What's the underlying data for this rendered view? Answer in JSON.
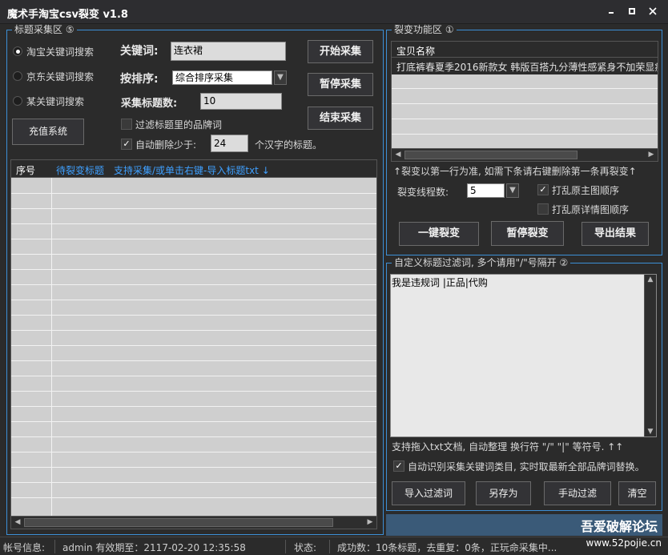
{
  "window": {
    "title": "魔术手淘宝csv裂变 v1.8",
    "controls": [
      "▫",
      "▫",
      "✕"
    ]
  },
  "collect_group": {
    "legend": "标题采集区 ⑤",
    "radios": [
      {
        "label": "淘宝关键词搜索",
        "checked": true
      },
      {
        "label": "京东关键词搜索",
        "checked": false
      },
      {
        "label": "某关键词搜索",
        "checked": false
      }
    ],
    "keyword_label": "关键词:",
    "keyword_value": "连衣裙",
    "sort_label": "按排序:",
    "sort_value": "综合排序采集",
    "count_label": "采集标题数:",
    "count_value": "10",
    "recharge_button": "充值系统",
    "filter_brand_label": "过滤标题里的品牌词",
    "auto_delete_label": "自动删除少于:",
    "auto_delete_value": "24",
    "auto_delete_suffix": "个汉字的标题。",
    "start_button": "开始采集",
    "pause_button": "暂停采集",
    "stop_button": "结束采集",
    "table_col1": "序号",
    "table_col2": "待裂变标题",
    "table_hint": "支持采集/或单击右键-导入标题txt ↓"
  },
  "fission_group": {
    "legend": "裂变功能区 ①",
    "table_header": "宝贝名称",
    "table_row1": "打底裤春夏季2016新款女 韩版百搭九分薄性感紧身不加荣显瘦",
    "hint": "↑裂变以第一行为准, 如需下条请右键删除第一条再裂变↑",
    "threads_label": "裂变线程数:",
    "threads_value": "5",
    "shuffle_main_label": "打乱原主图顺序",
    "shuffle_detail_label": "打乱原详情图顺序",
    "one_click_button": "一键裂变",
    "pause_button": "暂停裂变",
    "export_button": "导出结果"
  },
  "filter_group": {
    "legend": "自定义标题过滤词, 多个请用\"/\"号隔开 ②",
    "content": "我是违规词  |正品|代购",
    "hint": "支持拖入txt文档, 自动整理 换行符 \"/\" \"|\" 等符号. ↑↑",
    "auto_identify_label": "自动识别采集关键词类目, 实时取最新全部品牌词替换。",
    "import_button": "导入过滤词",
    "save_as_button": "另存为",
    "manual_filter_button": "手动过滤",
    "clear_button": "清空"
  },
  "watermark": {
    "main": "吾爱破解论坛",
    "url": "www.52pojie.cn"
  },
  "status": {
    "account_label": "帐号信息:",
    "account_value": "admin 有效期至：2117-02-20 12:35:58",
    "state_label": "状态:",
    "state_value": "成功数：10条标题，去重复：0条，正玩命采集中..."
  }
}
